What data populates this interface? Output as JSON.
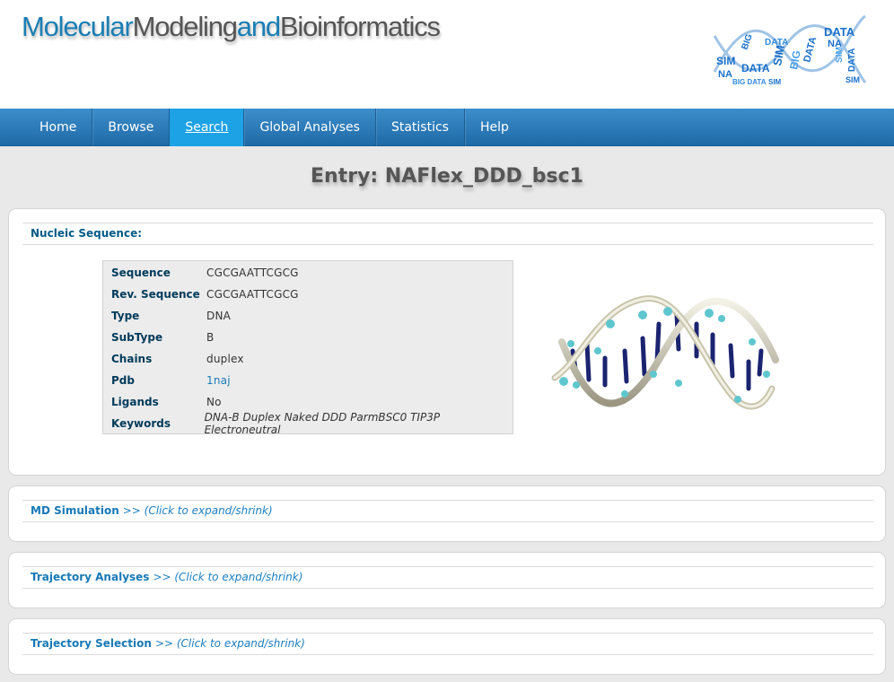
{
  "header": {
    "title_parts": [
      "Molecular",
      "Modeling",
      "and",
      "Bioinformatics"
    ],
    "logo_icon": "bigdata-dna-logo-icon"
  },
  "nav": {
    "items": [
      {
        "label": "Home",
        "active": false
      },
      {
        "label": "Browse",
        "active": false
      },
      {
        "label": "Search",
        "active": true
      },
      {
        "label": "Global Analyses",
        "active": false
      },
      {
        "label": "Statistics",
        "active": false
      },
      {
        "label": "Help",
        "active": false
      }
    ]
  },
  "page": {
    "title": "Entry: NAFlex_DDD_bsc1"
  },
  "nucleic": {
    "heading": "Nucleic Sequence:",
    "rows": [
      {
        "label": "Sequence",
        "value": "CGCGAATTCGCG"
      },
      {
        "label": "Rev. Sequence",
        "value": "CGCGAATTCGCG"
      },
      {
        "label": "Type",
        "value": "DNA"
      },
      {
        "label": "SubType",
        "value": "B"
      },
      {
        "label": "Chains",
        "value": "duplex"
      },
      {
        "label": "Pdb",
        "value": "1naj"
      },
      {
        "label": "Ligands",
        "value": "No"
      },
      {
        "label": "Keywords",
        "value": "DNA-B Duplex Naked DDD ParmBSC0 TIP3P Electroneutral"
      }
    ],
    "structure_image": "dna-double-helix-3d-icon"
  },
  "sections": [
    {
      "label": "MD Simulation",
      "hint": ">> (Click to expand/shrink)"
    },
    {
      "label": "Trajectory Analyses",
      "hint": ">> (Click to expand/shrink)"
    },
    {
      "label": "Trajectory Selection",
      "hint": ">> (Click to expand/shrink)"
    }
  ],
  "colors": {
    "brand_blue": "#1a7eb4",
    "nav_active": "#1ea2e6",
    "nav_bg": "#2a7bbb",
    "heading_dark": "#005a86"
  }
}
